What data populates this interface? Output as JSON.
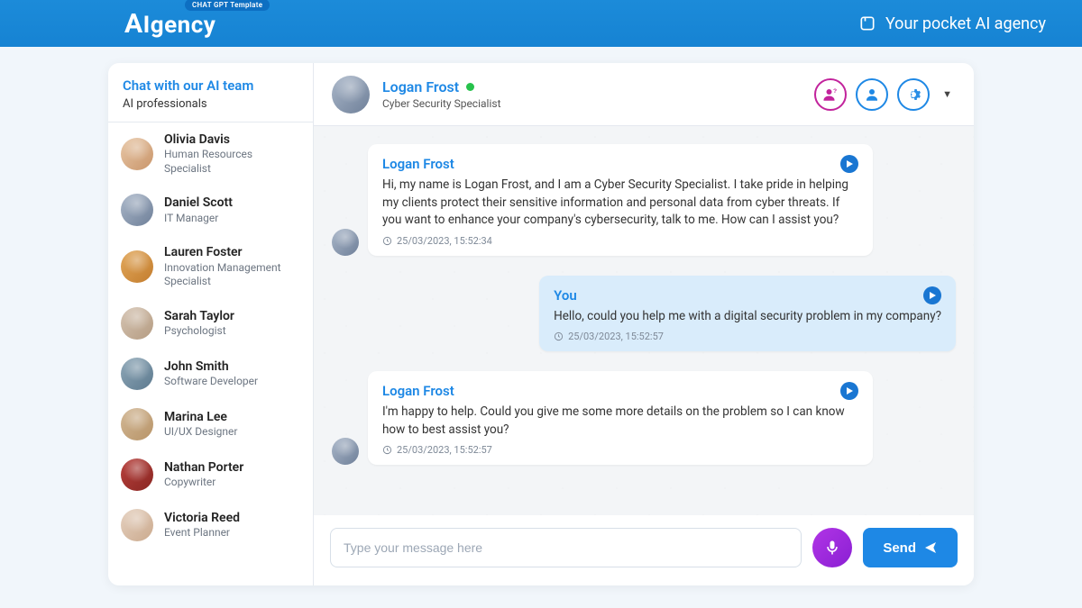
{
  "header": {
    "logo": "AIgency",
    "badge": "CHAT GPT Template",
    "tagline": "Your pocket AI agency"
  },
  "sidebar": {
    "title": "Chat with our AI team",
    "subtitle": "AI professionals",
    "contacts": [
      {
        "name": "Olivia Davis",
        "role": "Human Resources Specialist"
      },
      {
        "name": "Daniel Scott",
        "role": "IT Manager"
      },
      {
        "name": "Lauren Foster",
        "role": "Innovation Management Specialist"
      },
      {
        "name": "Sarah Taylor",
        "role": "Psychologist"
      },
      {
        "name": "John Smith",
        "role": "Software Developer"
      },
      {
        "name": "Marina Lee",
        "role": "UI/UX Designer"
      },
      {
        "name": "Nathan Porter",
        "role": "Copywriter"
      },
      {
        "name": "Victoria Reed",
        "role": "Event Planner"
      }
    ]
  },
  "chat": {
    "partner": {
      "name": "Logan Frost",
      "role": "Cyber Security Specialist",
      "online": true
    },
    "messages": [
      {
        "sender": "Logan Frost",
        "self": false,
        "text": "Hi, my name is Logan Frost, and I am a Cyber Security Specialist. I take pride in helping my clients protect their sensitive information and personal data from cyber threats. If you want to enhance your company's cybersecurity, talk to me. How can I assist you?",
        "time": "25/03/2023, 15:52:34"
      },
      {
        "sender": "You",
        "self": true,
        "text": "Hello, could you help me with a digital security problem in my company?",
        "time": "25/03/2023, 15:52:57"
      },
      {
        "sender": "Logan Frost",
        "self": false,
        "text": "I'm happy to help. Could you give me some more details on the problem so I can know how to best assist you?",
        "time": "25/03/2023, 15:52:57"
      }
    ],
    "input": {
      "placeholder": "Type your message here",
      "send_label": "Send"
    }
  }
}
